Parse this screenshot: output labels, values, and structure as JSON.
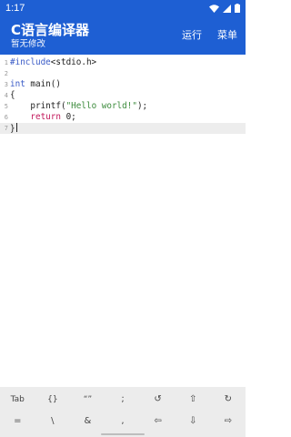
{
  "status_bar": {
    "time": "1:17",
    "icons": [
      "wifi-icon",
      "signal-icon",
      "battery-icon"
    ]
  },
  "app_bar": {
    "title": "C语言编译器",
    "subtitle": "暂无修改",
    "actions": {
      "run": "运行",
      "menu": "菜单"
    },
    "color": "#1e5fd3"
  },
  "editor": {
    "lines": [
      {
        "number": "1",
        "tokens": [
          {
            "text": "#include",
            "kind": "pre"
          },
          {
            "text": "<stdio.h>",
            "kind": "plain"
          }
        ]
      },
      {
        "number": "2",
        "tokens": []
      },
      {
        "number": "3",
        "tokens": [
          {
            "text": "int",
            "kind": "kw"
          },
          {
            "text": " main()",
            "kind": "plain"
          }
        ]
      },
      {
        "number": "4",
        "tokens": [
          {
            "text": "{",
            "kind": "plain"
          }
        ]
      },
      {
        "number": "5",
        "tokens": [
          {
            "text": "    printf(",
            "kind": "plain"
          },
          {
            "text": "\"Hello world!\"",
            "kind": "str"
          },
          {
            "text": ");",
            "kind": "plain"
          }
        ]
      },
      {
        "number": "6",
        "tokens": [
          {
            "text": "    ",
            "kind": "plain"
          },
          {
            "text": "return",
            "kind": "ret"
          },
          {
            "text": " 0;",
            "kind": "plain"
          }
        ]
      },
      {
        "number": "7",
        "tokens": [
          {
            "text": "}",
            "kind": "plain"
          }
        ],
        "active": true
      }
    ],
    "colors": {
      "keyword": "#3a5bc7",
      "string": "#3a8a3a",
      "return": "#c2185b",
      "active_line": "#ededed"
    }
  },
  "shortcut_keys": {
    "row1": [
      "Tab",
      "{}",
      "“”",
      ";",
      "↺",
      "⇧",
      "↻"
    ],
    "row2": [
      "=",
      "\\",
      "&",
      ",",
      "⇦",
      "⇩",
      "⇨"
    ]
  }
}
